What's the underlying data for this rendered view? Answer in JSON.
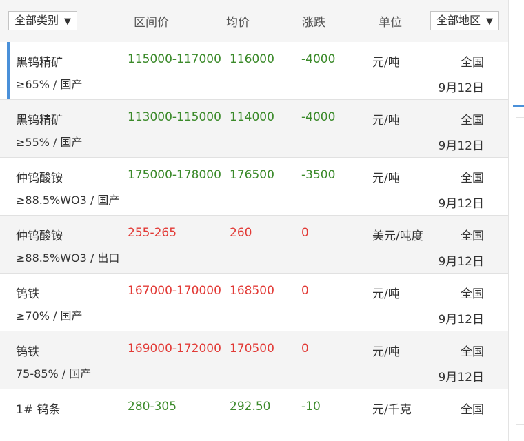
{
  "header": {
    "category_select": "全部类别",
    "col_range": "区间价",
    "col_avg": "均价",
    "col_change": "涨跌",
    "col_unit": "单位",
    "region_select": "全部地区",
    "caret": "▼"
  },
  "rows": [
    {
      "name": "黑钨精矿",
      "spec": "≥65% / 国产",
      "range": "115000-117000",
      "avg": "116000",
      "change": "-4000",
      "unit": "元/吨",
      "region": "全国",
      "date": "9月12日",
      "trend": "down",
      "color": "#3b8a2a"
    },
    {
      "name": "黑钨精矿",
      "spec": "≥55% / 国产",
      "range": "113000-115000",
      "avg": "114000",
      "change": "-4000",
      "unit": "元/吨",
      "region": "全国",
      "date": "9月12日",
      "trend": "down",
      "color": "#3b8a2a"
    },
    {
      "name": "仲钨酸铵",
      "spec": "≥88.5%WO3 / 国产",
      "range": "175000-178000",
      "avg": "176500",
      "change": "-3500",
      "unit": "元/吨",
      "region": "全国",
      "date": "9月12日",
      "trend": "down",
      "color": "#3b8a2a"
    },
    {
      "name": "仲钨酸铵",
      "spec": "≥88.5%WO3 / 出口",
      "range": "255-265",
      "avg": "260",
      "change": "0",
      "unit": "美元/吨度",
      "region": "全国",
      "date": "9月12日",
      "trend": "flat",
      "color": "#e23a36"
    },
    {
      "name": "钨铁",
      "spec": "≥70% / 国产",
      "range": "167000-170000",
      "avg": "168500",
      "change": "0",
      "unit": "元/吨",
      "region": "全国",
      "date": "9月12日",
      "trend": "flat",
      "color": "#e23a36"
    },
    {
      "name": "钨铁",
      "spec": "75-85% / 国产",
      "range": "169000-172000",
      "avg": "170500",
      "change": "0",
      "unit": "元/吨",
      "region": "全国",
      "date": "9月12日",
      "trend": "flat",
      "color": "#e23a36"
    },
    {
      "name": "1# 钨条",
      "spec": "",
      "range": "280-305",
      "avg": "292.50",
      "change": "-10",
      "unit": "元/千克",
      "region": "全国",
      "date": "",
      "trend": "down",
      "color": "#3b8a2a"
    }
  ]
}
